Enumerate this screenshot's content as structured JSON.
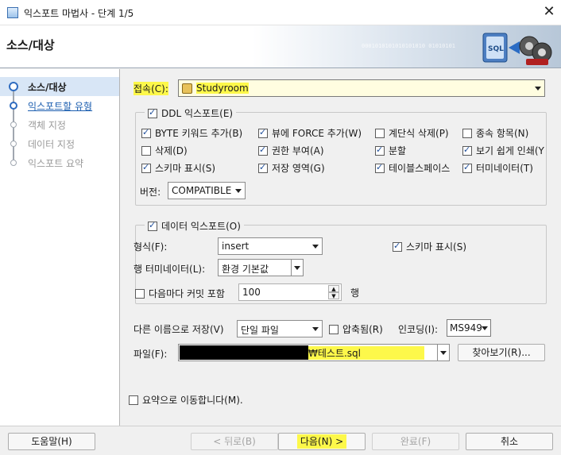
{
  "window": {
    "title": "익스포트 마법사 - 단계 1/5",
    "close_glyph": "✕",
    "header_title": "소스/대상",
    "header_binary": "0001010101010101010  01010101",
    "header_art_text": "SQL"
  },
  "steps": [
    {
      "label": "소스/대상",
      "state": "active"
    },
    {
      "label": "익스포트할 유형",
      "state": "link"
    },
    {
      "label": "객체 지정",
      "state": "disabled"
    },
    {
      "label": "데이터 지정",
      "state": "disabled"
    },
    {
      "label": "익스포트 요약",
      "state": "disabled"
    }
  ],
  "connection": {
    "label": "접속(C):",
    "value": "Studyroom"
  },
  "ddl": {
    "label": "DDL 익스포트(E)",
    "checked": true,
    "options": [
      {
        "label": "BYTE 키워드 추가(B)",
        "checked": true
      },
      {
        "label": "뷰에 FORCE 추가(W)",
        "checked": true
      },
      {
        "label": "계단식 삭제(P)",
        "checked": false
      },
      {
        "label": "종속 항목(N)",
        "checked": false
      },
      {
        "label": "삭제(D)",
        "checked": false
      },
      {
        "label": "권한 부여(A)",
        "checked": true
      },
      {
        "label": "분할",
        "checked": true
      },
      {
        "label": "보기 쉽게 인쇄(Y",
        "checked": true
      },
      {
        "label": "스키마 표시(S)",
        "checked": true
      },
      {
        "label": "저장 영역(G)",
        "checked": true
      },
      {
        "label": "테이블스페이스",
        "checked": true
      },
      {
        "label": "터미네이터(T)",
        "checked": true
      }
    ],
    "version_label": "버전:",
    "version_value": "COMPATIBLE"
  },
  "data_export": {
    "label": "데이터 익스포트(O)",
    "checked": true,
    "format_label": "형식(F):",
    "format_value": "insert",
    "show_schema_label": "스키마 표시(S)",
    "show_schema_checked": true,
    "row_terminator_label": "행 터미네이터(L):",
    "row_terminator_value": "환경 기본값",
    "commit_label": "다음마다 커밋 포함",
    "commit_checked": false,
    "commit_value": "100",
    "commit_unit": "행"
  },
  "save": {
    "save_as_label": "다른 이름으로 저장(V)",
    "save_as_value": "단일 파일",
    "compressed_label": "압축됨(R)",
    "compressed_checked": false,
    "encoding_label": "인코딩(I):",
    "encoding_value": "MS949",
    "file_label": "파일(F):",
    "file_value": "₩테스트.sql",
    "browse_label": "찾아보기(R)..."
  },
  "summary_jump": {
    "label": "요약으로 이동합니다(M).",
    "checked": false
  },
  "buttons": {
    "help": "도움말(H)",
    "back": "< 뒤로(B)",
    "next": "다음(N) >",
    "finish": "완료(F)",
    "cancel": "취소"
  },
  "colors": {
    "highlight": "#fdf84a",
    "active_step_bg": "#d8e6f6",
    "link": "#1d5fb0"
  }
}
